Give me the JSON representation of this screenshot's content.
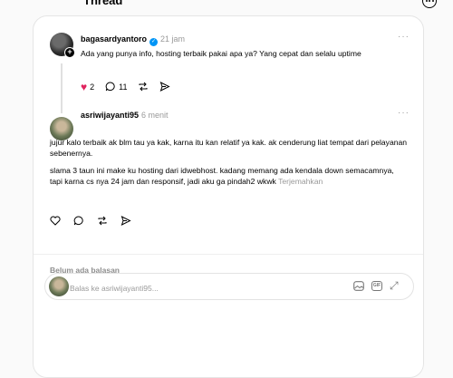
{
  "header": {
    "title": "Thread"
  },
  "original_post": {
    "username": "bagasardyantoro",
    "time": "21 jam",
    "text": "Ada yang punya info, hosting terbaik pakai apa ya? Yang cepat dan selalu uptime",
    "likes": "2",
    "comments": "11"
  },
  "reply_post": {
    "username": "asriwijayanti95",
    "time": "6 menit",
    "paragraph1": "jujur kalo terbaik ak blm tau ya kak, karna itu kan relatif ya kak. ak cenderung liat tempat dari pelayanan sebenernya.",
    "paragraph2": "slama 3 taun ini make ku hosting dari idwebhost. kadang memang ada kendala down semacamnya, tapi karna cs nya 24 jam dan responsif, jadi aku ga pindah2 wkwk",
    "translate": "Terjemahkan"
  },
  "replies": {
    "empty_label": "Belum ada balasan"
  },
  "reply_input": {
    "placeholder": "Balas ke asriwijayanti95..."
  },
  "icons": {
    "like": "heart-icon",
    "comment": "comment-icon",
    "repost": "repost-icon",
    "share": "share-icon",
    "image": "image-icon",
    "gif": "gif-icon",
    "expand": "expand-icon"
  },
  "colors": {
    "like_active": "#e0245e",
    "verified": "#0095f6",
    "muted": "#999999"
  }
}
